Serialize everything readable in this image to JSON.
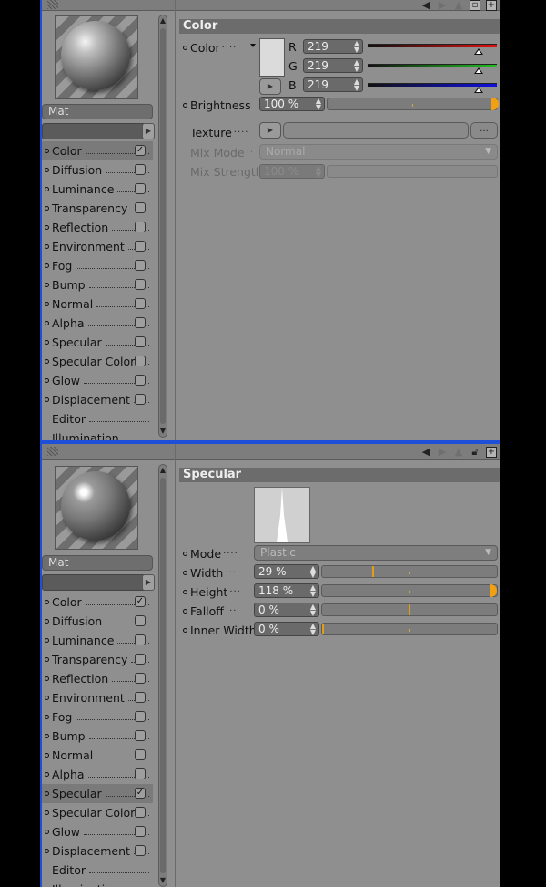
{
  "colors": {
    "panel_bg": "#8f8f8f",
    "accent_blue": "#1d4fd8",
    "slider_marker": "#e39d16"
  },
  "top_panel": {
    "toolbar_icons": [
      "triangle-left-icon",
      "triangle-right-icon",
      "arrow-up-icon",
      "camera-icon",
      "add-icon"
    ],
    "material_name": "Mat",
    "channels": [
      {
        "label": "Color",
        "checked": true,
        "selected": true
      },
      {
        "label": "Diffusion",
        "checked": false
      },
      {
        "label": "Luminance",
        "checked": false
      },
      {
        "label": "Transparency",
        "checked": false
      },
      {
        "label": "Reflection",
        "checked": false
      },
      {
        "label": "Environment",
        "checked": false
      },
      {
        "label": "Fog",
        "checked": false
      },
      {
        "label": "Bump",
        "checked": false
      },
      {
        "label": "Normal",
        "checked": false
      },
      {
        "label": "Alpha",
        "checked": false
      },
      {
        "label": "Specular",
        "checked": false
      },
      {
        "label": "Specular Color",
        "checked": false
      },
      {
        "label": "Glow",
        "checked": false
      },
      {
        "label": "Displacement",
        "checked": false
      },
      {
        "label": "Editor"
      },
      {
        "label": "Illumination"
      }
    ],
    "section_title": "Color",
    "color_label": "Color",
    "r_label": "R",
    "g_label": "G",
    "b_label": "B",
    "r_value": "219",
    "g_value": "219",
    "b_value": "219",
    "rgb_level": 0.859,
    "swatch_color": "#dbdbdb",
    "brightness_label": "Brightness",
    "brightness_value": "100 %",
    "texture_label": "Texture",
    "texture_button": "...",
    "mix_mode_label": "Mix Mode",
    "mix_mode_value": "Normal",
    "mix_strength_label": "Mix Strength",
    "mix_strength_value": "100 %"
  },
  "bottom_panel": {
    "toolbar_icons": [
      "triangle-left-icon",
      "triangle-right-icon",
      "arrow-up-icon",
      "lock-icon",
      "add-icon"
    ],
    "material_name": "Mat",
    "channels": [
      {
        "label": "Color",
        "checked": true
      },
      {
        "label": "Diffusion",
        "checked": false
      },
      {
        "label": "Luminance",
        "checked": false
      },
      {
        "label": "Transparency",
        "checked": false
      },
      {
        "label": "Reflection",
        "checked": false
      },
      {
        "label": "Environment",
        "checked": false
      },
      {
        "label": "Fog",
        "checked": false
      },
      {
        "label": "Bump",
        "checked": false
      },
      {
        "label": "Normal",
        "checked": false
      },
      {
        "label": "Alpha",
        "checked": false
      },
      {
        "label": "Specular",
        "checked": true,
        "selected": true
      },
      {
        "label": "Specular Color",
        "checked": false
      },
      {
        "label": "Glow",
        "checked": false
      },
      {
        "label": "Displacement",
        "checked": false
      },
      {
        "label": "Editor"
      },
      {
        "label": "Illumination"
      }
    ],
    "section_title": "Specular",
    "mode_label": "Mode",
    "mode_value": "Plastic",
    "width_label": "Width",
    "width_value": "29 %",
    "width_level": 0.29,
    "height_label": "Height",
    "height_value": "118 %",
    "height_level": 1.0,
    "falloff_label": "Falloff",
    "falloff_value": "0 %",
    "falloff_level": 0.5,
    "inner_width_label": "Inner Width",
    "inner_width_value": "0 %",
    "inner_width_level": 0.0
  }
}
